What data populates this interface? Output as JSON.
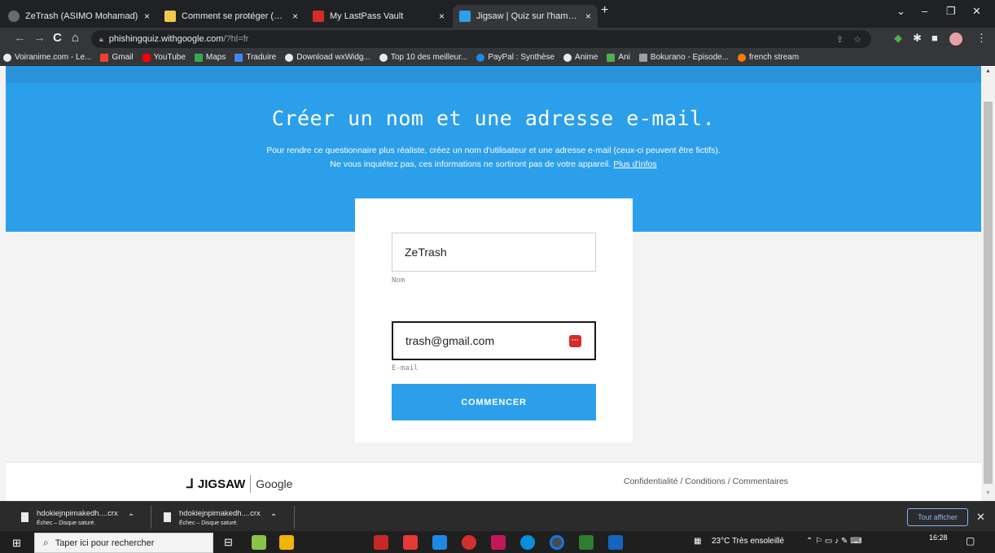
{
  "tabs": [
    {
      "title": "ZeTrash (ASIMO Mohamad)",
      "fav_color": "#6a6a6a"
    },
    {
      "title": "Comment se protéger (un peu) c",
      "fav_color": "#f2c94c"
    },
    {
      "title": "My LastPass Vault",
      "fav_color": "#d32d27"
    },
    {
      "title": "Jigsaw | Quiz sur l'hameçonnage",
      "fav_color": "#2c9fea"
    }
  ],
  "omnibox": {
    "host": "phishingquiz.withgoogle.com",
    "path": "/?hl=fr"
  },
  "bookmarks": [
    {
      "label": "Voiranime.com - Le...",
      "color": "#e8eaed"
    },
    {
      "label": "Gmail",
      "color": "#ea4335"
    },
    {
      "label": "YouTube",
      "color": "#ff0000"
    },
    {
      "label": "Maps",
      "color": "#34a853"
    },
    {
      "label": "Traduire",
      "color": "#4285f4"
    },
    {
      "label": "Download wxWidg...",
      "color": "#e8eaed"
    },
    {
      "label": "Top 10 des meilleur...",
      "color": "#e8eaed"
    },
    {
      "label": "PayPal : Synthèse",
      "color": "#1e88e5"
    },
    {
      "label": "Anime",
      "color": "#e8eaed"
    },
    {
      "label": "Ani",
      "color": "#4caf50"
    },
    {
      "label": "Bokurano - Episode...",
      "color": "#9aa0a6"
    },
    {
      "label": "french stream",
      "color": "#f57c00"
    }
  ],
  "hero": {
    "title": "Créer un nom et une adresse e-mail.",
    "desc_line1": "Pour rendre ce questionnaire plus réaliste, créez un nom d'utilisateur et une adresse e-mail (ceux-ci peuvent être fictifs).",
    "desc_line2": "Ne vous inquiétez pas, ces informations ne sortiront pas de votre appareil.",
    "more_link": "Plus d'infos"
  },
  "form": {
    "name_value": "ZeTrash",
    "name_label": "Nom",
    "email_value": "trash@gmail.com",
    "email_label": "E-mail",
    "lastpass_glyph": "···",
    "start_label": "COMMENCER"
  },
  "footer": {
    "brand": "JIGSAW",
    "google": "Google",
    "links": "Confidentialité / Conditions / Commentaires"
  },
  "downloads": {
    "items": [
      {
        "name": "hdokiejnpimakedh....crx",
        "status": "Échec – Disque saturé."
      },
      {
        "name": "hdokiejnpimakedh....crx",
        "status": "Échec – Disque saturé."
      }
    ],
    "show_all": "Tout afficher"
  },
  "taskbar": {
    "search_placeholder": "Taper ici pour rechercher",
    "weather": "23°C  Très ensoleillé",
    "time": "16:28"
  },
  "colors": {
    "accent": "#2c9fea",
    "lastpass": "#d32d27"
  }
}
